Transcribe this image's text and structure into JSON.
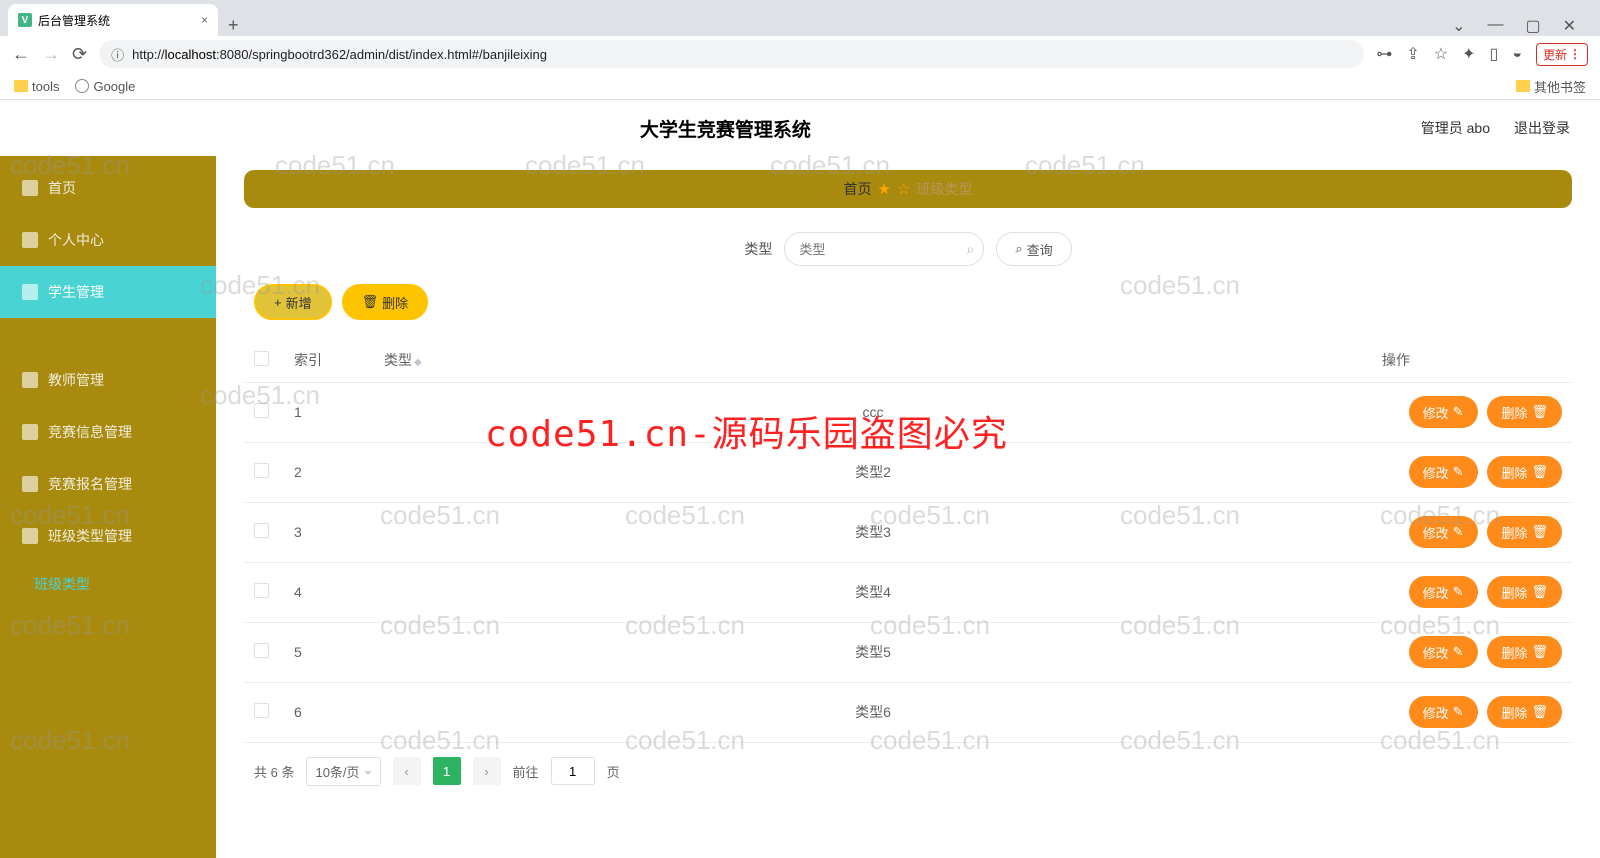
{
  "browser": {
    "tab_title": "后台管理系统",
    "url_prefix": "http://",
    "url_host": "localhost",
    "url_path": ":8080/springbootrd362/admin/dist/index.html#/banjileixing",
    "bookmarks": {
      "tools": "tools",
      "google": "Google",
      "other": "其他书签"
    },
    "update": "更新"
  },
  "header": {
    "title": "大学生竞赛管理系统",
    "user": "管理员 abo",
    "logout": "退出登录"
  },
  "sidebar": {
    "items": [
      {
        "label": "首页"
      },
      {
        "label": "个人中心"
      },
      {
        "label": "学生管理"
      },
      {
        "label": "教师管理"
      },
      {
        "label": "竞赛信息管理"
      },
      {
        "label": "竞赛报名管理"
      },
      {
        "label": "班级类型管理"
      }
    ],
    "submenu": "班级类型"
  },
  "breadcrumb": {
    "home": "首页",
    "current": "班级类型"
  },
  "search": {
    "label": "类型",
    "placeholder": "类型",
    "query": "查询"
  },
  "actions": {
    "add": "新增",
    "delete": "删除"
  },
  "table": {
    "cols": {
      "index": "索引",
      "type": "类型",
      "ops": "操作"
    },
    "rows": [
      {
        "i": "1",
        "t": "ccc"
      },
      {
        "i": "2",
        "t": "类型2"
      },
      {
        "i": "3",
        "t": "类型3"
      },
      {
        "i": "4",
        "t": "类型4"
      },
      {
        "i": "5",
        "t": "类型5"
      },
      {
        "i": "6",
        "t": "类型6"
      }
    ],
    "edit": "修改",
    "del": "删除"
  },
  "pagination": {
    "total": "共 6 条",
    "size": "10条/页",
    "goto": "前往",
    "page": "1",
    "suffix": "页"
  },
  "watermark": "code51.cn",
  "overlay": "code51.cn-源码乐园盗图必究"
}
